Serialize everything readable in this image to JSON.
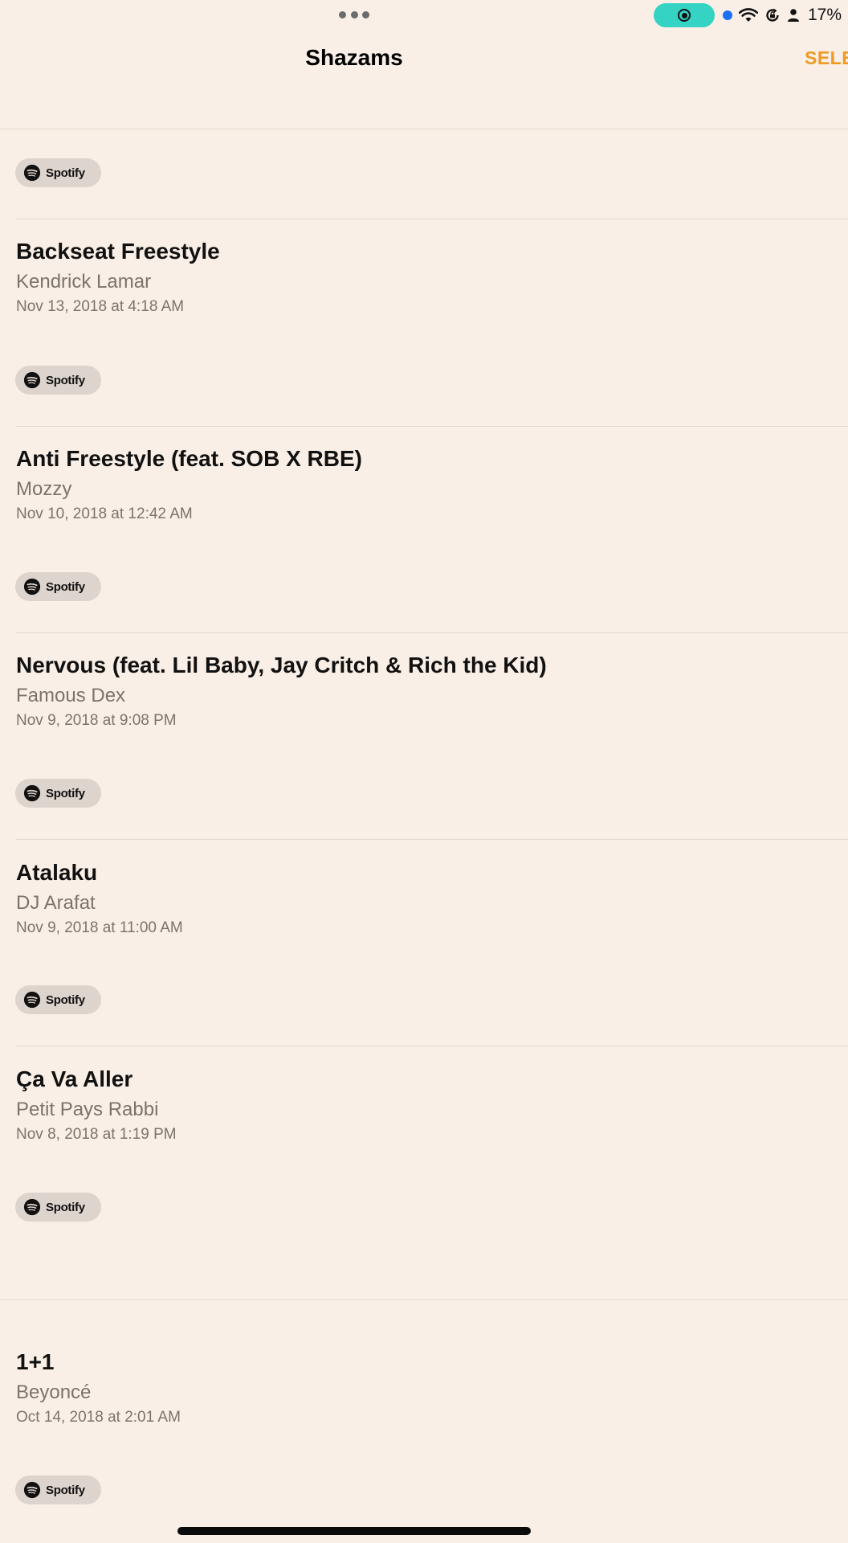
{
  "status_bar": {
    "battery_percent": "17%",
    "colors": {
      "recording_pill": "#34d3c4",
      "location_dot": "#1d6ff2",
      "battery": "#b0179b"
    },
    "icons": [
      "wifi-icon",
      "orientation-lock-icon",
      "person-icon",
      "battery-icon"
    ]
  },
  "header": {
    "title": "Shazams",
    "select_label": "SELE",
    "accent_color": "#ee9a25"
  },
  "spotify_label": "Spotify",
  "tracks": [
    {
      "title": "Backseat Freestyle",
      "artist": "Kendrick Lamar",
      "date": "Nov 13, 2018 at 4:18 AM"
    },
    {
      "title": "Anti Freestyle (feat. SOB X RBE)",
      "artist": "Mozzy",
      "date": "Nov 10, 2018 at 12:42 AM"
    },
    {
      "title": "Nervous (feat. Lil Baby, Jay Critch & Rich the Kid)",
      "artist": "Famous Dex",
      "date": "Nov 9, 2018 at 9:08 PM"
    },
    {
      "title": "Atalaku",
      "artist": "DJ Arafat",
      "date": "Nov 9, 2018 at 11:00 AM"
    },
    {
      "title": "Ça Va Aller",
      "artist": "Petit Pays Rabbi",
      "date": "Nov 8, 2018 at 1:19 PM"
    },
    {
      "title": "1+1",
      "artist": "Beyoncé",
      "date": "Oct 14, 2018 at 2:01 AM"
    }
  ]
}
